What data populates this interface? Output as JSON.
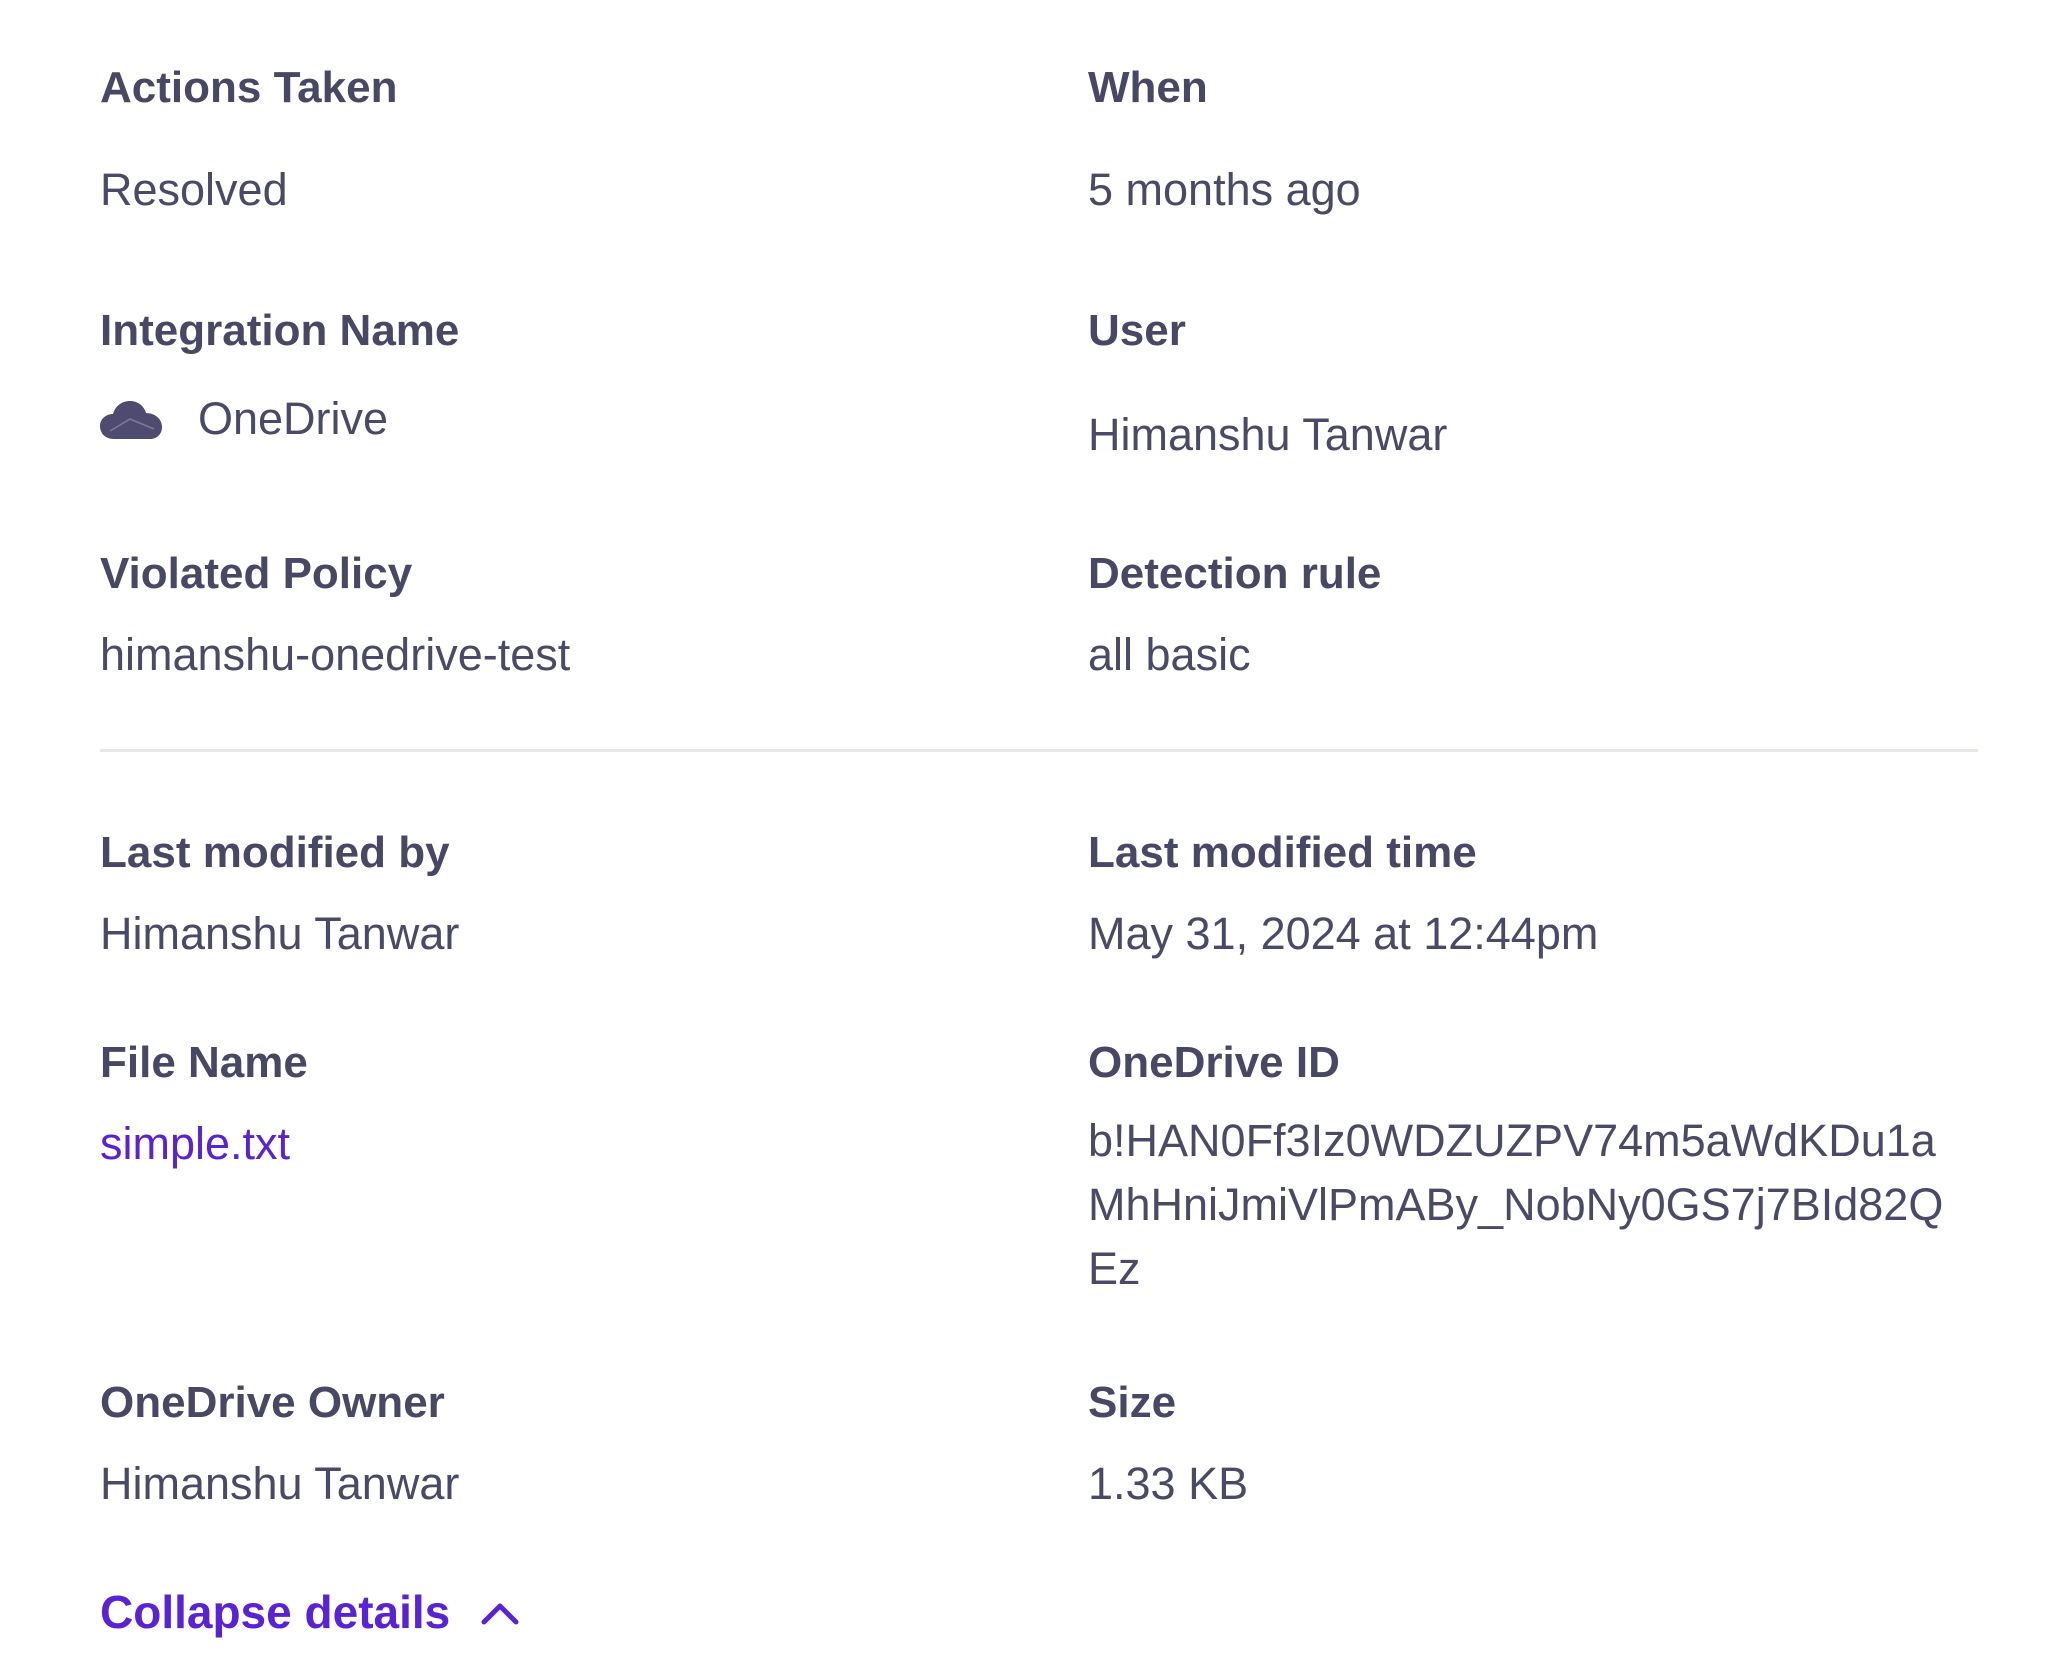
{
  "details": {
    "actions_taken": {
      "label": "Actions Taken",
      "value": "Resolved"
    },
    "when": {
      "label": "When",
      "value": "5 months ago"
    },
    "integration_name": {
      "label": "Integration Name",
      "value": "OneDrive",
      "icon": "cloud-icon"
    },
    "user": {
      "label": "User",
      "value": "Himanshu Tanwar"
    },
    "violated_policy": {
      "label": "Violated Policy",
      "value": "himanshu-onedrive-test"
    },
    "detection_rule": {
      "label": "Detection rule",
      "value": "all basic"
    },
    "last_modified_by": {
      "label": "Last modified by",
      "value": "Himanshu Tanwar"
    },
    "last_modified_time": {
      "label": "Last modified time",
      "value": "May 31, 2024 at 12:44pm"
    },
    "file_name": {
      "label": "File Name",
      "value": "simple.txt"
    },
    "onedrive_id": {
      "label": "OneDrive ID",
      "value": "b!HAN0Ff3Iz0WDZUZPV74m5aWdKDu1aMhHniJmiVlPmABy_NobNy0GS7j7BId82QEz"
    },
    "onedrive_owner": {
      "label": "OneDrive Owner",
      "value": "Himanshu Tanwar"
    },
    "size": {
      "label": "Size",
      "value": "1.33 KB"
    }
  },
  "collapse": {
    "label": "Collapse details",
    "icon": "chevron-up-icon"
  },
  "colors": {
    "label": "#484866",
    "value": "#4a4a68",
    "accent": "#5a22d6",
    "divider": "#e6e6ec",
    "cloud_icon": "#4e4a70"
  }
}
